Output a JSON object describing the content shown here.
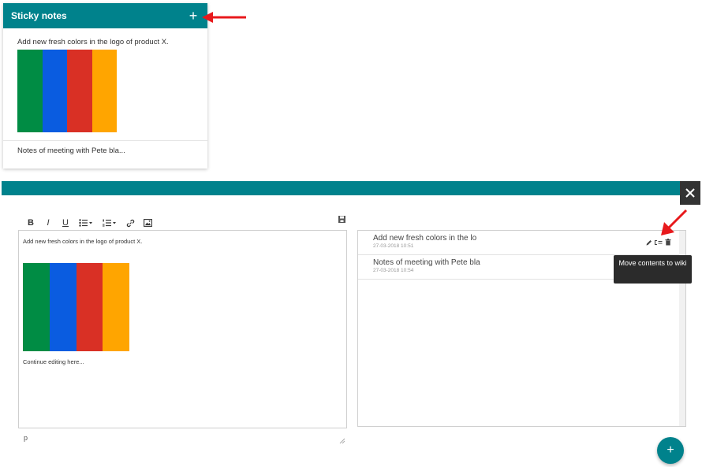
{
  "widget": {
    "title": "Sticky notes",
    "add_label": "+",
    "notes": [
      {
        "text": "Add new fresh colors in the logo of product X."
      },
      {
        "text": "Notes of meeting with Pete bla..."
      }
    ]
  },
  "swatch_colors": [
    "#008c44",
    "#0a5ce0",
    "#d93025",
    "#ffa500"
  ],
  "toolbar": {
    "bold": "B",
    "italic": "I",
    "underline": "U",
    "bullet_list": "bullet-list-icon",
    "numbered_list": "numbered-list-icon",
    "link": "link-icon",
    "image": "image-icon",
    "save": "save-icon"
  },
  "editor": {
    "line_1": "Add new fresh colors in the logo of product X.",
    "line_2": "Continue editing here...",
    "status_path": "p"
  },
  "list": {
    "items": [
      {
        "title": "Add new fresh colors in the lo",
        "date": "27-03-2018 10:51"
      },
      {
        "title": "Notes of meeting with Pete bla",
        "date": "27-03-2018 10:54"
      }
    ]
  },
  "tooltip": "Move contents to wiki",
  "close_icon": "close-icon",
  "fab_label": "+",
  "accent_color": "#00828c",
  "annotation_color": "#e8191c"
}
